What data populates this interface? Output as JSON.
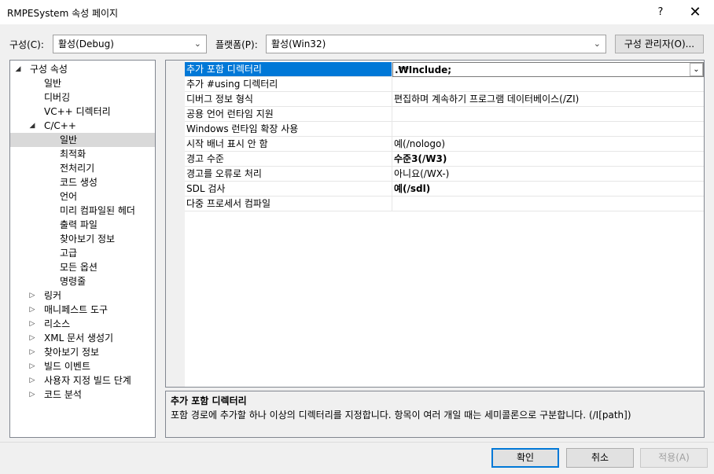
{
  "window": {
    "title": "RMPESystem 속성 페이지",
    "help": "?",
    "close": "✕"
  },
  "config_bar": {
    "config_label": "구성(C):",
    "config_value": "활성(Debug)",
    "platform_label": "플랫폼(P):",
    "platform_value": "활성(Win32)",
    "manager_button": "구성 관리자(O)..."
  },
  "tree": [
    {
      "label": "구성 속성",
      "level": 0,
      "arrow": "◢"
    },
    {
      "label": "일반",
      "level": 1
    },
    {
      "label": "디버깅",
      "level": 1
    },
    {
      "label": "VC++ 디렉터리",
      "level": 1
    },
    {
      "label": "C/C++",
      "level": 1,
      "arrow": "◢"
    },
    {
      "label": "일반",
      "level": 2,
      "selected": true
    },
    {
      "label": "최적화",
      "level": 2
    },
    {
      "label": "전처리기",
      "level": 2
    },
    {
      "label": "코드 생성",
      "level": 2
    },
    {
      "label": "언어",
      "level": 2
    },
    {
      "label": "미리 컴파일된 헤더",
      "level": 2
    },
    {
      "label": "출력 파일",
      "level": 2
    },
    {
      "label": "찾아보기 정보",
      "level": 2
    },
    {
      "label": "고급",
      "level": 2
    },
    {
      "label": "모든 옵션",
      "level": 2
    },
    {
      "label": "명령줄",
      "level": 2
    },
    {
      "label": "링커",
      "level": 1,
      "arrow": "▷"
    },
    {
      "label": "매니페스트 도구",
      "level": 1,
      "arrow": "▷"
    },
    {
      "label": "리소스",
      "level": 1,
      "arrow": "▷"
    },
    {
      "label": "XML 문서 생성기",
      "level": 1,
      "arrow": "▷"
    },
    {
      "label": "찾아보기 정보",
      "level": 1,
      "arrow": "▷"
    },
    {
      "label": "빌드 이벤트",
      "level": 1,
      "arrow": "▷"
    },
    {
      "label": "사용자 지정 빌드 단계",
      "level": 1,
      "arrow": "▷"
    },
    {
      "label": "코드 분석",
      "level": 1,
      "arrow": "▷"
    }
  ],
  "properties": [
    {
      "name": "추가 포함 디렉터리",
      "value": ".₩Include;",
      "bold": true,
      "selected": true
    },
    {
      "name": "추가 #using 디렉터리",
      "value": ""
    },
    {
      "name": "디버그 정보 형식",
      "value": "편집하며 계속하기 프로그램 데이터베이스(/ZI)"
    },
    {
      "name": "공용 언어 런타임 지원",
      "value": ""
    },
    {
      "name": "Windows 런타임 확장 사용",
      "value": ""
    },
    {
      "name": "시작 배너 표시 안 함",
      "value": "예(/nologo)"
    },
    {
      "name": "경고 수준",
      "value": "수준3(/W3)",
      "bold": true
    },
    {
      "name": "경고를 오류로 처리",
      "value": "아니요(/WX-)"
    },
    {
      "name": "SDL 검사",
      "value": "예(/sdl)",
      "bold": true
    },
    {
      "name": "다중 프로세서 컴파일",
      "value": ""
    }
  ],
  "description": {
    "title": "추가 포함 디렉터리",
    "text": "포함 경로에 추가할 하나 이상의 디렉터리를 지정합니다. 항목이 여러 개일 때는 세미콜론으로 구분합니다.      (/I[path])"
  },
  "buttons": {
    "ok": "확인",
    "cancel": "취소",
    "apply": "적용(A)"
  }
}
